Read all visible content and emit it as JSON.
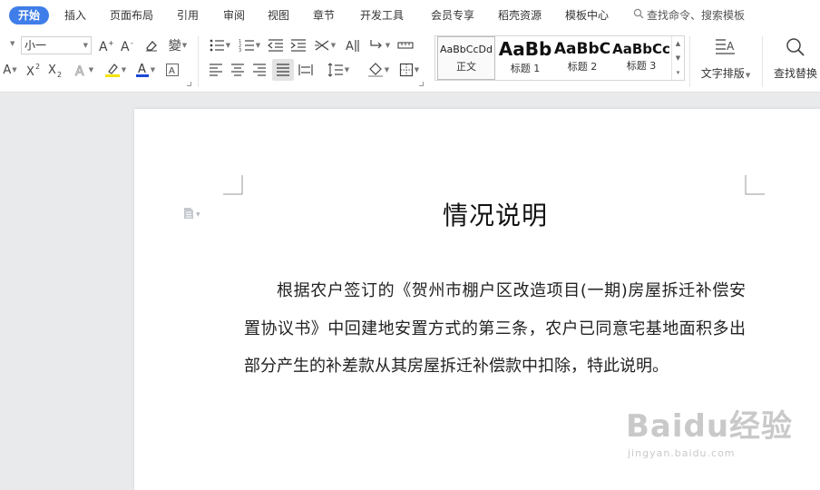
{
  "menu": {
    "tabs": [
      {
        "label": "开始",
        "active": true
      },
      {
        "label": "插入"
      },
      {
        "label": "页面布局"
      },
      {
        "label": "引用"
      },
      {
        "label": "审阅"
      },
      {
        "label": "视图"
      },
      {
        "label": "章节"
      },
      {
        "label": "开发工具"
      },
      {
        "label": "会员专享"
      },
      {
        "label": "稻壳资源"
      },
      {
        "label": "模板中心"
      }
    ],
    "search_label": "查找命令、搜索模板"
  },
  "ribbon": {
    "font_size": "小一",
    "styles": [
      {
        "sample": "AaBbCcDd",
        "name": "正文"
      },
      {
        "sample": "AaBb",
        "name": "标题 1"
      },
      {
        "sample": "AaBbC",
        "name": "标题 2"
      },
      {
        "sample": "AaBbCc",
        "name": "标题 3"
      }
    ],
    "text_layout_label": "文字排版",
    "find_replace_label": "查找替换"
  },
  "document": {
    "title": "情况说明",
    "body": "根据农户签订的《贺州市棚户区改造项目(一期)房屋拆迁补偿安置协议书》中回建地安置方式的第三条，农户已同意宅基地面积多出部分产生的补差款从其房屋拆迁补偿款中扣除，特此说明。"
  },
  "watermark": {
    "brand": "Baidu经验",
    "url": "jingyan.baidu.com"
  },
  "colors": {
    "accent": "#3f7ee8",
    "highlight_yellow": "#f5e300",
    "font_color_blue": "#1d49d8"
  }
}
